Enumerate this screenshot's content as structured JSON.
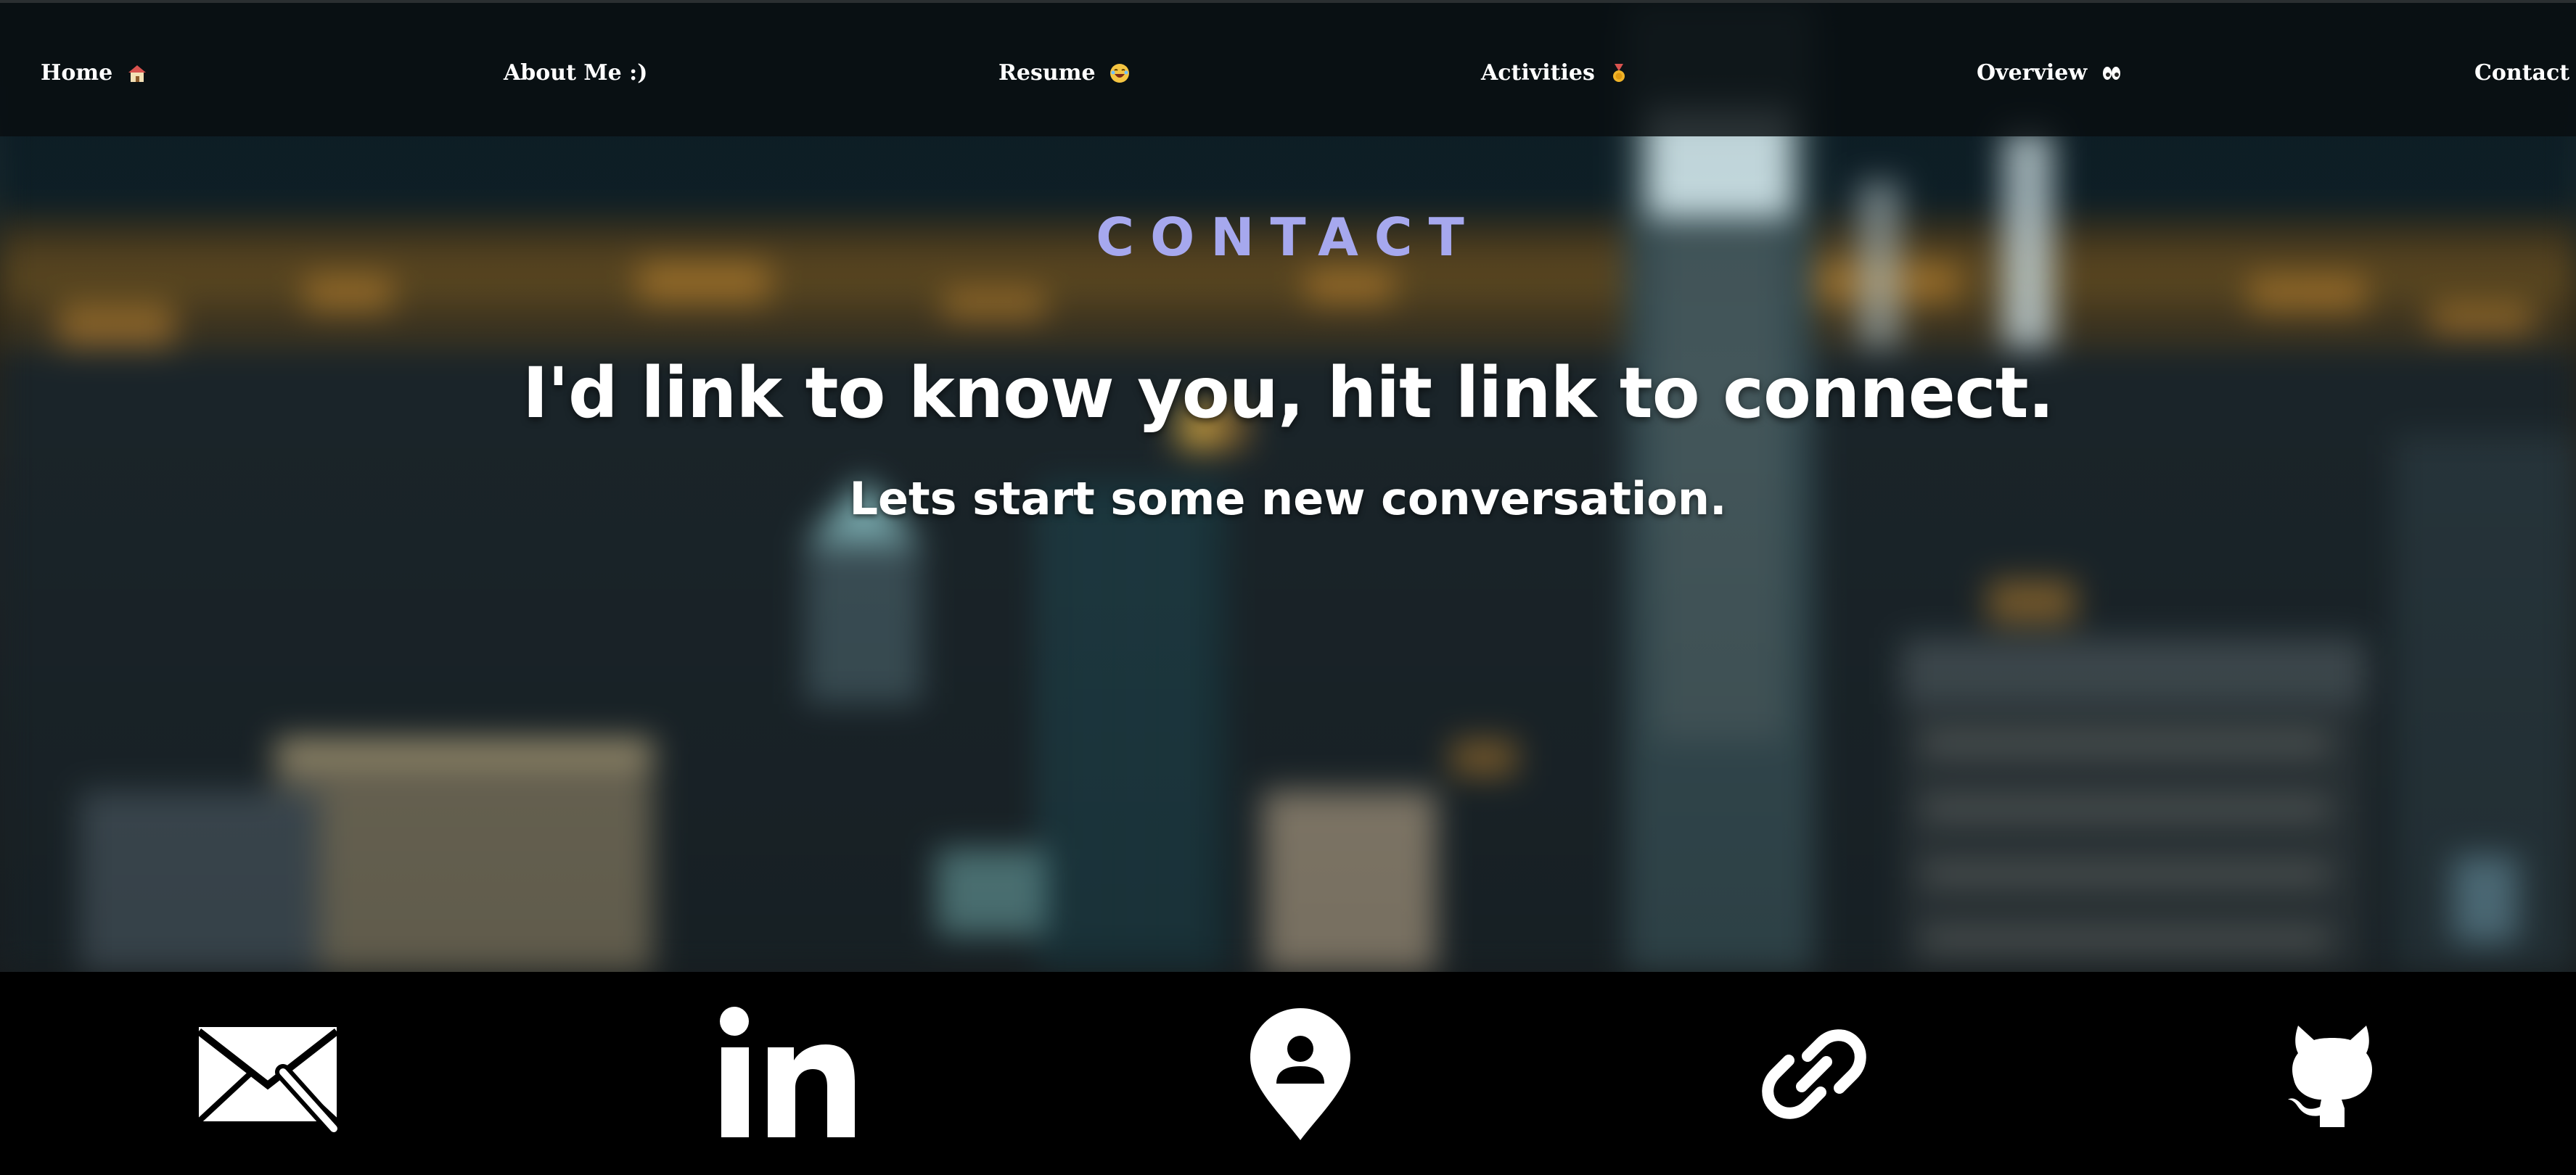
{
  "nav": {
    "items": [
      {
        "label": "Home",
        "icon": "house-emoji-icon"
      },
      {
        "label": "About Me :)",
        "icon": ""
      },
      {
        "label": "Resume",
        "icon": "laughing-emoji-icon"
      },
      {
        "label": "Activities",
        "icon": "medal-emoji-icon"
      },
      {
        "label": "Overview",
        "icon": "eyes-emoji-icon"
      },
      {
        "label": "Contact",
        "icon": "mailbox-emoji-icon"
      }
    ]
  },
  "hero": {
    "section_title": "CONTACT",
    "headline": "I'd link to know you, hit link to connect.",
    "subheadline": "Lets start some new conversation."
  },
  "social": {
    "icons": [
      "email-icon",
      "linkedin-icon",
      "profile-location-icon",
      "link-icon",
      "github-icon"
    ]
  },
  "colors": {
    "accent": "#a6a8ee",
    "text": "#ffffff",
    "navbar_bg": "#080e10",
    "footer_bg": "#000000"
  }
}
